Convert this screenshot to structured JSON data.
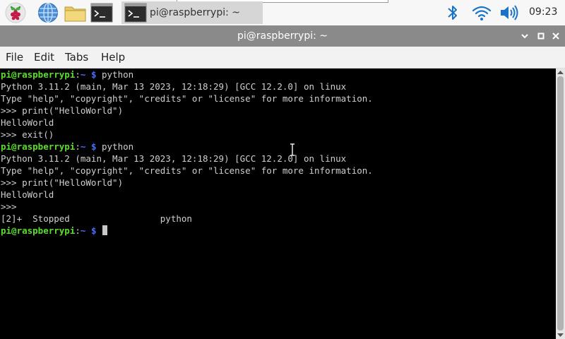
{
  "taskbar": {
    "task_label": "pi@raspberrypi: ~",
    "clock": "09:23"
  },
  "window": {
    "title": "pi@raspberrypi: ~"
  },
  "menu": {
    "file": "File",
    "edit": "Edit",
    "tabs": "Tabs",
    "help": "Help"
  },
  "terminal": {
    "user_host": "pi@raspberrypi",
    "sep": ":",
    "path": "~",
    "prompt_symbol": " $ ",
    "lines": [
      "python",
      "Python 3.11.2 (main, Mar 13 2023, 12:18:29) [GCC 12.2.0] on linux",
      "Type \"help\", \"copyright\", \"credits\" or \"license\" for more information.",
      ">>> print(\"HelloWorld\")",
      "HelloWorld",
      ">>> exit()",
      "python",
      "Python 3.11.2 (main, Mar 13 2023, 12:18:29) [GCC 12.2.0] on linux",
      "Type \"help\", \"copyright\", \"credits\" or \"license\" for more information.",
      ">>> print(\"HelloWorld\")",
      "HelloWorld",
      ">>>",
      "[2]+  Stopped                 python",
      ""
    ]
  },
  "colors": {
    "user_host": "#5bde2c",
    "path": "#4b6eff",
    "terminal_bg": "#000000",
    "titlebar": "#8a8a8a",
    "accent": "#1a73c8"
  },
  "icons": {
    "menu": "raspberry-icon",
    "browser": "globe-icon",
    "files": "folder-icon",
    "terminal": "terminal-icon",
    "bluetooth": "bluetooth-icon",
    "wifi": "wifi-icon",
    "volume": "volume-icon"
  }
}
